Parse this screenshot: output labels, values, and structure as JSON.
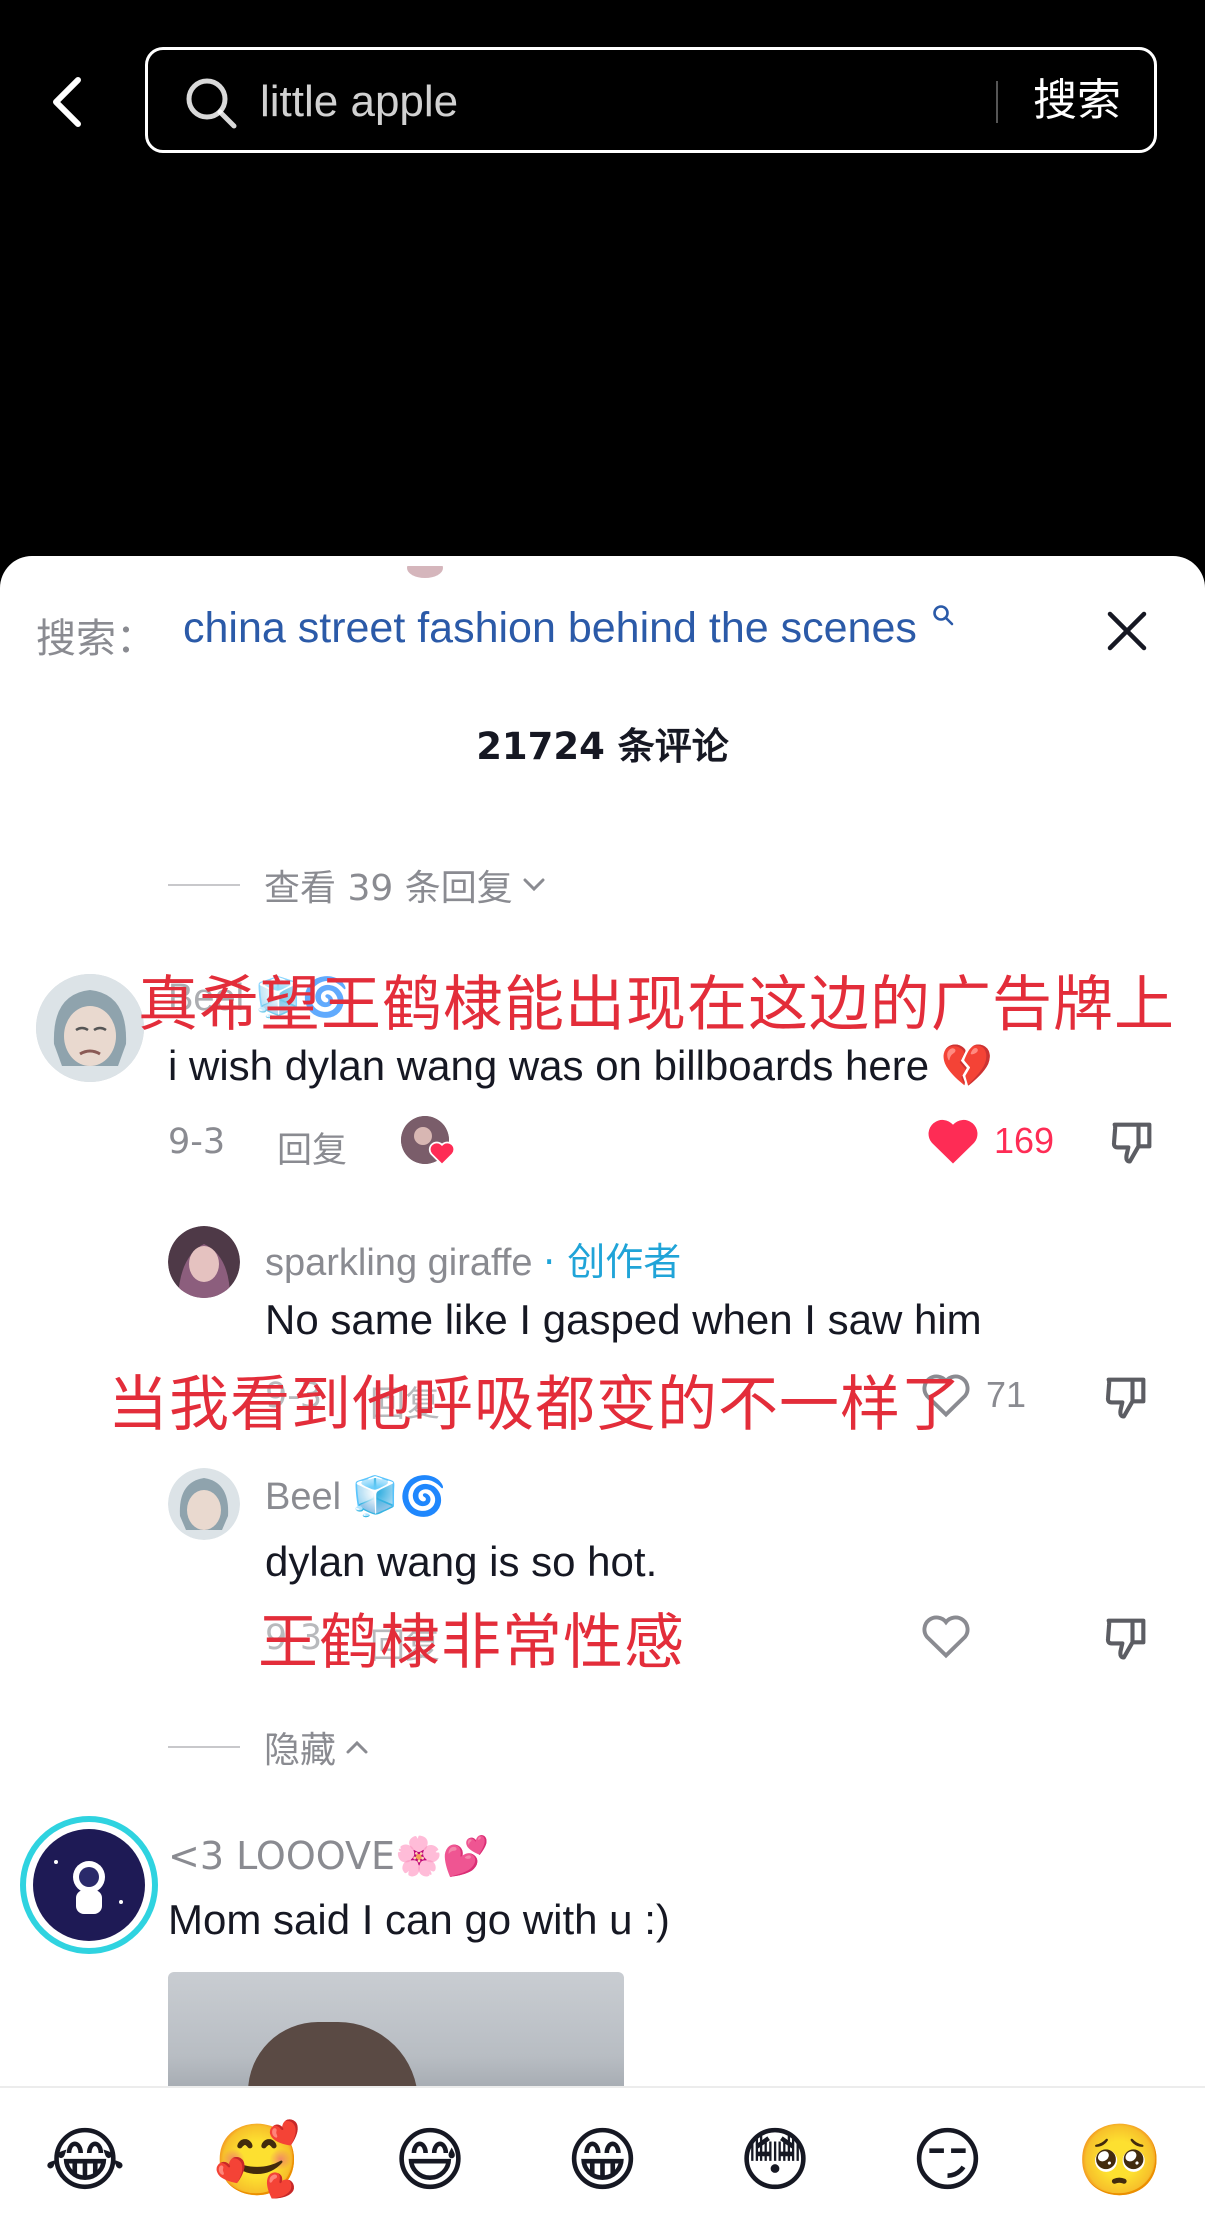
{
  "search": {
    "query": "little apple",
    "button_label": "搜索"
  },
  "sheet": {
    "search_prefix": "搜索：",
    "search_link": "china street fashion behind the scenes",
    "comment_count": "21724 条评论",
    "view_more": "查看 39 条回复",
    "hide": "隐藏"
  },
  "comments": [
    {
      "username": "Beel 🧊🌀",
      "text": "i wish dylan wang was on billboards here 💔",
      "date": "9-3",
      "reply_label": "回复",
      "likes": "169",
      "liked": true,
      "annotation": "真希望王鹤棣能出现在这边的广告牌上"
    },
    {
      "username": "sparkling giraffe",
      "creator_tag": "· 创作者",
      "text": "No same like I gasped when I saw him",
      "date": "9-3",
      "reply_label": "回复",
      "likes": "71",
      "liked": false,
      "annotation": "当我看到他呼吸都变的不一样了"
    },
    {
      "username": "Beel",
      "username_emoji": "🧊🌀",
      "text": "dylan wang is so hot.",
      "date": "9-3",
      "reply_label": "回复",
      "likes": "",
      "liked": false,
      "annotation": "王鹤棣非常性感"
    },
    {
      "username": "<3 LOOOVE🌸💕",
      "text": "Mom said I can go with u :)"
    }
  ],
  "emoji_bar": [
    "😂",
    "🥰",
    "😅",
    "😁",
    "😳",
    "😏",
    "🥺"
  ],
  "colors": {
    "accent_red": "#e32d3a",
    "link_blue": "#2b5aa8",
    "creator_blue": "#20a4d8",
    "like_red": "#fe2c55"
  }
}
